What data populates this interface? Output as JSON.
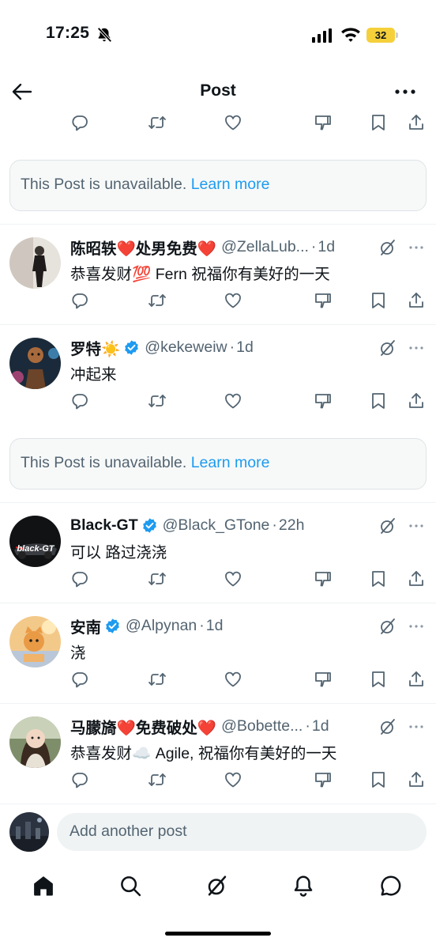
{
  "status_bar": {
    "time": "17:25",
    "battery": "32"
  },
  "header": {
    "title": "Post"
  },
  "unavailable_notice": {
    "text": "This Post is unavailable.",
    "link": "Learn more"
  },
  "replies": [
    {
      "name": "陈昭轶❤️处男免费❤️",
      "handle": "@ZellaLub...",
      "time": "1d",
      "text": "恭喜发财💯 Fern 祝福你有美好的一天",
      "verified": false
    },
    {
      "name": "罗特☀️",
      "handle": "@kekeweiw",
      "time": "1d",
      "text": "冲起来",
      "verified": true
    },
    {
      "name": "Black-GT",
      "handle": "@Black_GTone",
      "time": "22h",
      "text": "可以 路过浇浇",
      "verified": true
    },
    {
      "name": "安南",
      "handle": "@Alpynan",
      "time": "1d",
      "text": "浇",
      "verified": true
    },
    {
      "name": "马朦旖❤️免费破处❤️",
      "handle": "@Bobette...",
      "time": "1d",
      "text": "恭喜发财☁️ Agile, 祝福你有美好的一天",
      "verified": false
    }
  ],
  "composer": {
    "placeholder": "Add another post"
  },
  "tabs": [
    "home-icon",
    "search-icon",
    "grok-icon",
    "notifications-icon",
    "messages-icon"
  ],
  "colors": {
    "accent": "#1d9bf0",
    "secondary_text": "#536471",
    "battery": "#f5d03b"
  }
}
